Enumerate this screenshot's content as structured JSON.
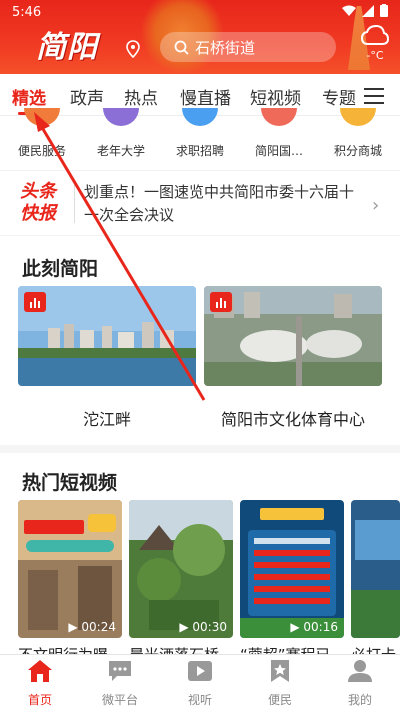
{
  "status_bar": {
    "time": "5:46"
  },
  "header": {
    "logo": "简阳",
    "search_text": "石桥街道",
    "weather": "-°C"
  },
  "tabs": [
    {
      "label": "精选",
      "active": true
    },
    {
      "label": "政声"
    },
    {
      "label": "热点"
    },
    {
      "label": "慢直播"
    },
    {
      "label": "短视频"
    },
    {
      "label": "专题"
    }
  ],
  "services": [
    {
      "label": "便民服务",
      "icon": "service-icon"
    },
    {
      "label": "老年大学",
      "icon": "elderly-icon"
    },
    {
      "label": "求职招聘",
      "icon": "job-icon"
    },
    {
      "label": "简阳国…",
      "icon": "national-icon"
    },
    {
      "label": "积分商城",
      "icon": "mall-icon"
    }
  ],
  "headline": {
    "badge_line1": "头条",
    "badge_line2": "快报",
    "text": "划重点！一图速览中共简阳市委十六届十一次全会决议"
  },
  "section_now": {
    "title": "此刻简阳",
    "cards": [
      {
        "label": "沱江畔"
      },
      {
        "label": "简阳市文化体育中心"
      }
    ]
  },
  "section_videos": {
    "title": "热门短视频",
    "videos": [
      {
        "label": "不文明行为曝",
        "duration": "00:24"
      },
      {
        "label": "晨光洒落石桥",
        "duration": "00:30"
      },
      {
        "label": "“蓉超”赛程已",
        "duration": "00:16"
      },
      {
        "label": "必打卡",
        "duration": ""
      }
    ]
  },
  "bottom_nav": [
    {
      "label": "首页",
      "active": true
    },
    {
      "label": "微平台"
    },
    {
      "label": "视听"
    },
    {
      "label": "便民"
    },
    {
      "label": "我的"
    }
  ],
  "colors": {
    "accent": "#e8261b"
  }
}
